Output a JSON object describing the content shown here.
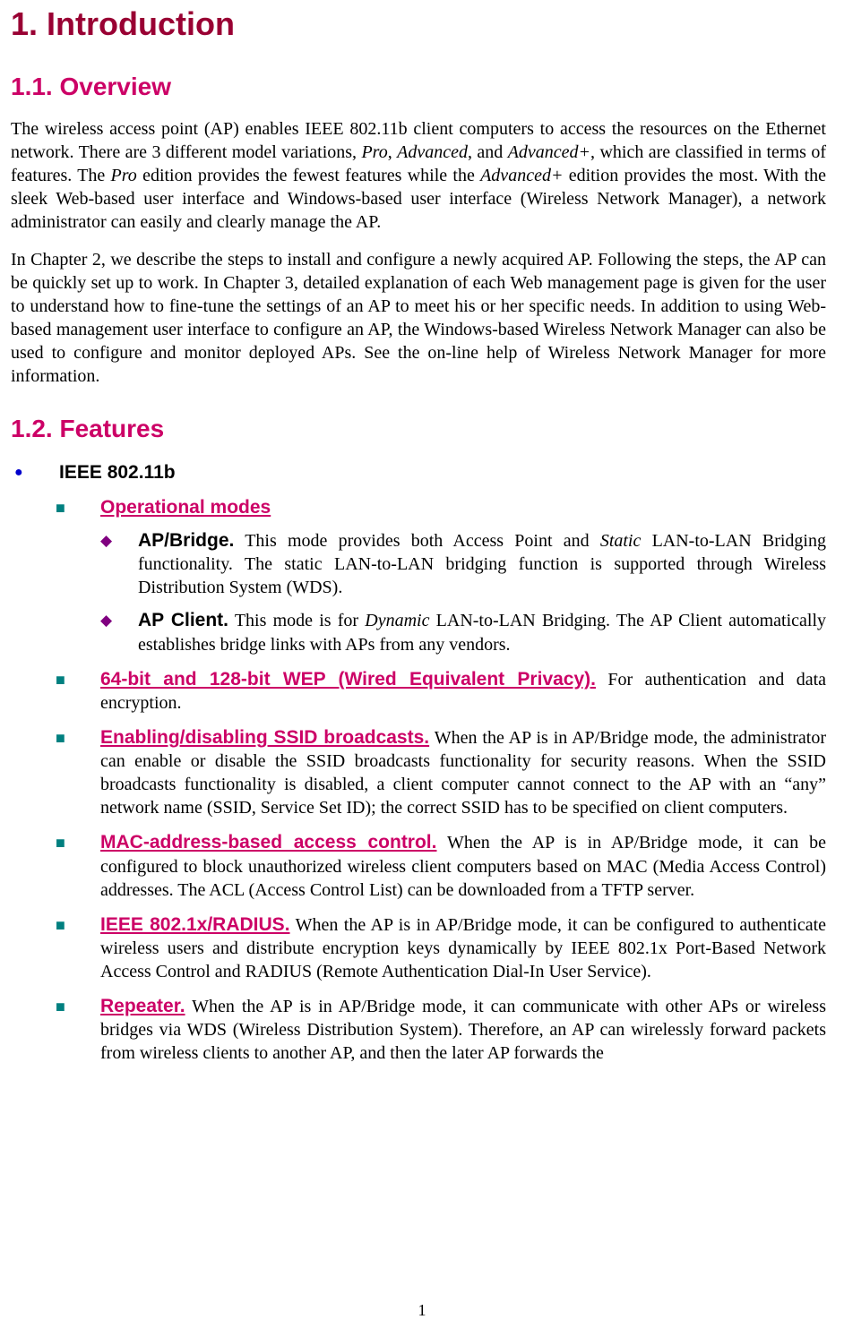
{
  "h1": "1. Introduction",
  "h2_overview": "1.1. Overview",
  "overview_p1_a": "The wireless access point (AP) enables IEEE 802.11b client computers to access the resources on the Ethernet network. There are 3 different model variations, ",
  "overview_p1_pro": "Pro",
  "overview_p1_b": ", ",
  "overview_p1_adv": "Advanced",
  "overview_p1_c": ", and ",
  "overview_p1_advp": "Advanced+",
  "overview_p1_d": ", which are classified in terms of features. The ",
  "overview_p1_pro2": "Pro",
  "overview_p1_e": " edition provides the fewest features while the ",
  "overview_p1_advp2": "Advanced+",
  "overview_p1_f": " edition provides the most. With the sleek Web-based user interface and Windows-based user interface (Wireless Network Manager), a network administrator can easily and clearly manage the AP.",
  "overview_p2": "In Chapter 2, we describe the steps to install and configure a newly acquired AP. Following the steps, the AP can be quickly set up to work. In Chapter 3, detailed explanation of each Web management page is given for the user to understand how to fine-tune the settings of an AP to meet his or her specific needs. In addition to using Web-based management user interface to configure an AP, the Windows-based Wireless Network Manager can also be used to configure and monitor deployed APs. See the on-line help of Wireless Network Manager for more information.",
  "h2_features": "1.2. Features",
  "feat1": "IEEE 802.11b",
  "opmodes_head": "Operational modes",
  "apbridge_name": "AP/Bridge.",
  "apbridge_a": " This mode provides both Access Point and ",
  "apbridge_static": "Static",
  "apbridge_b": " LAN-to-LAN Bridging functionality. The static LAN-to-LAN bridging function is supported through Wireless Distribution System (WDS).",
  "apclient_name": "AP Client.",
  "apclient_a": " This mode is for ",
  "apclient_dynamic": "Dynamic",
  "apclient_b": " LAN-to-LAN Bridging. The AP Client automatically establishes bridge links with APs from any vendors.",
  "wep_head": "64-bit and 128-bit WEP (Wired Equivalent Privacy).",
  "wep_body": " For authentication and data encryption.",
  "ssid_head": "Enabling/disabling SSID broadcasts.",
  "ssid_body": " When the AP is in AP/Bridge mode, the administrator can enable or disable the SSID broadcasts functionality for security reasons. When the SSID broadcasts functionality is disabled, a client computer cannot connect to the AP with an “any” network name (SSID, Service Set ID); the correct SSID has to be specified on client computers.",
  "mac_head": "MAC-address-based access control.",
  "mac_body": " When the AP is in AP/Bridge mode, it can be configured to block unauthorized wireless client computers based on MAC (Media Access Control) addresses. The ACL (Access Control List) can be downloaded from a TFTP server.",
  "radius_head": "IEEE 802.1x/RADIUS.",
  "radius_body": " When the AP is in AP/Bridge mode, it can be configured to authenticate wireless users and distribute encryption keys dynamically by IEEE 802.1x Port-Based Network Access Control and RADIUS (Remote Authentication Dial-In User Service).",
  "repeater_head": "Repeater.",
  "repeater_body": " When the AP is in AP/Bridge mode, it can communicate with other APs or wireless bridges via WDS (Wireless Distribution System). Therefore, an AP can wirelessly forward packets from wireless clients to another AP, and then the later AP forwards the",
  "pagenum": "1"
}
